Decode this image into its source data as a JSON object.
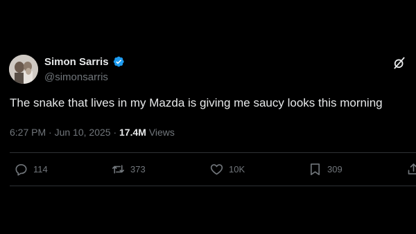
{
  "author": {
    "display_name": "Simon Sarris",
    "handle": "@simonsarris",
    "verified": true
  },
  "tweet": {
    "text": "The snake that lives in my Mazda is giving me saucy looks this morning"
  },
  "meta": {
    "time": "6:27 PM",
    "separator": "·",
    "date": "Jun 10, 2025",
    "views_count": "17.4M",
    "views_label": "Views"
  },
  "actions": {
    "replies": "114",
    "reposts": "373",
    "likes": "10K",
    "bookmarks": "309"
  },
  "icons": {
    "reply": "reply-icon",
    "repost": "repost-icon",
    "like": "heart-icon",
    "bookmark": "bookmark-icon",
    "share": "share-icon",
    "grok": "grok-icon",
    "verified": "verified-badge-icon"
  },
  "colors": {
    "background": "#000000",
    "primary_text": "#e7e9ea",
    "secondary_text": "#71767b",
    "divider": "#2f3336",
    "verified_blue": "#1d9bf0"
  }
}
